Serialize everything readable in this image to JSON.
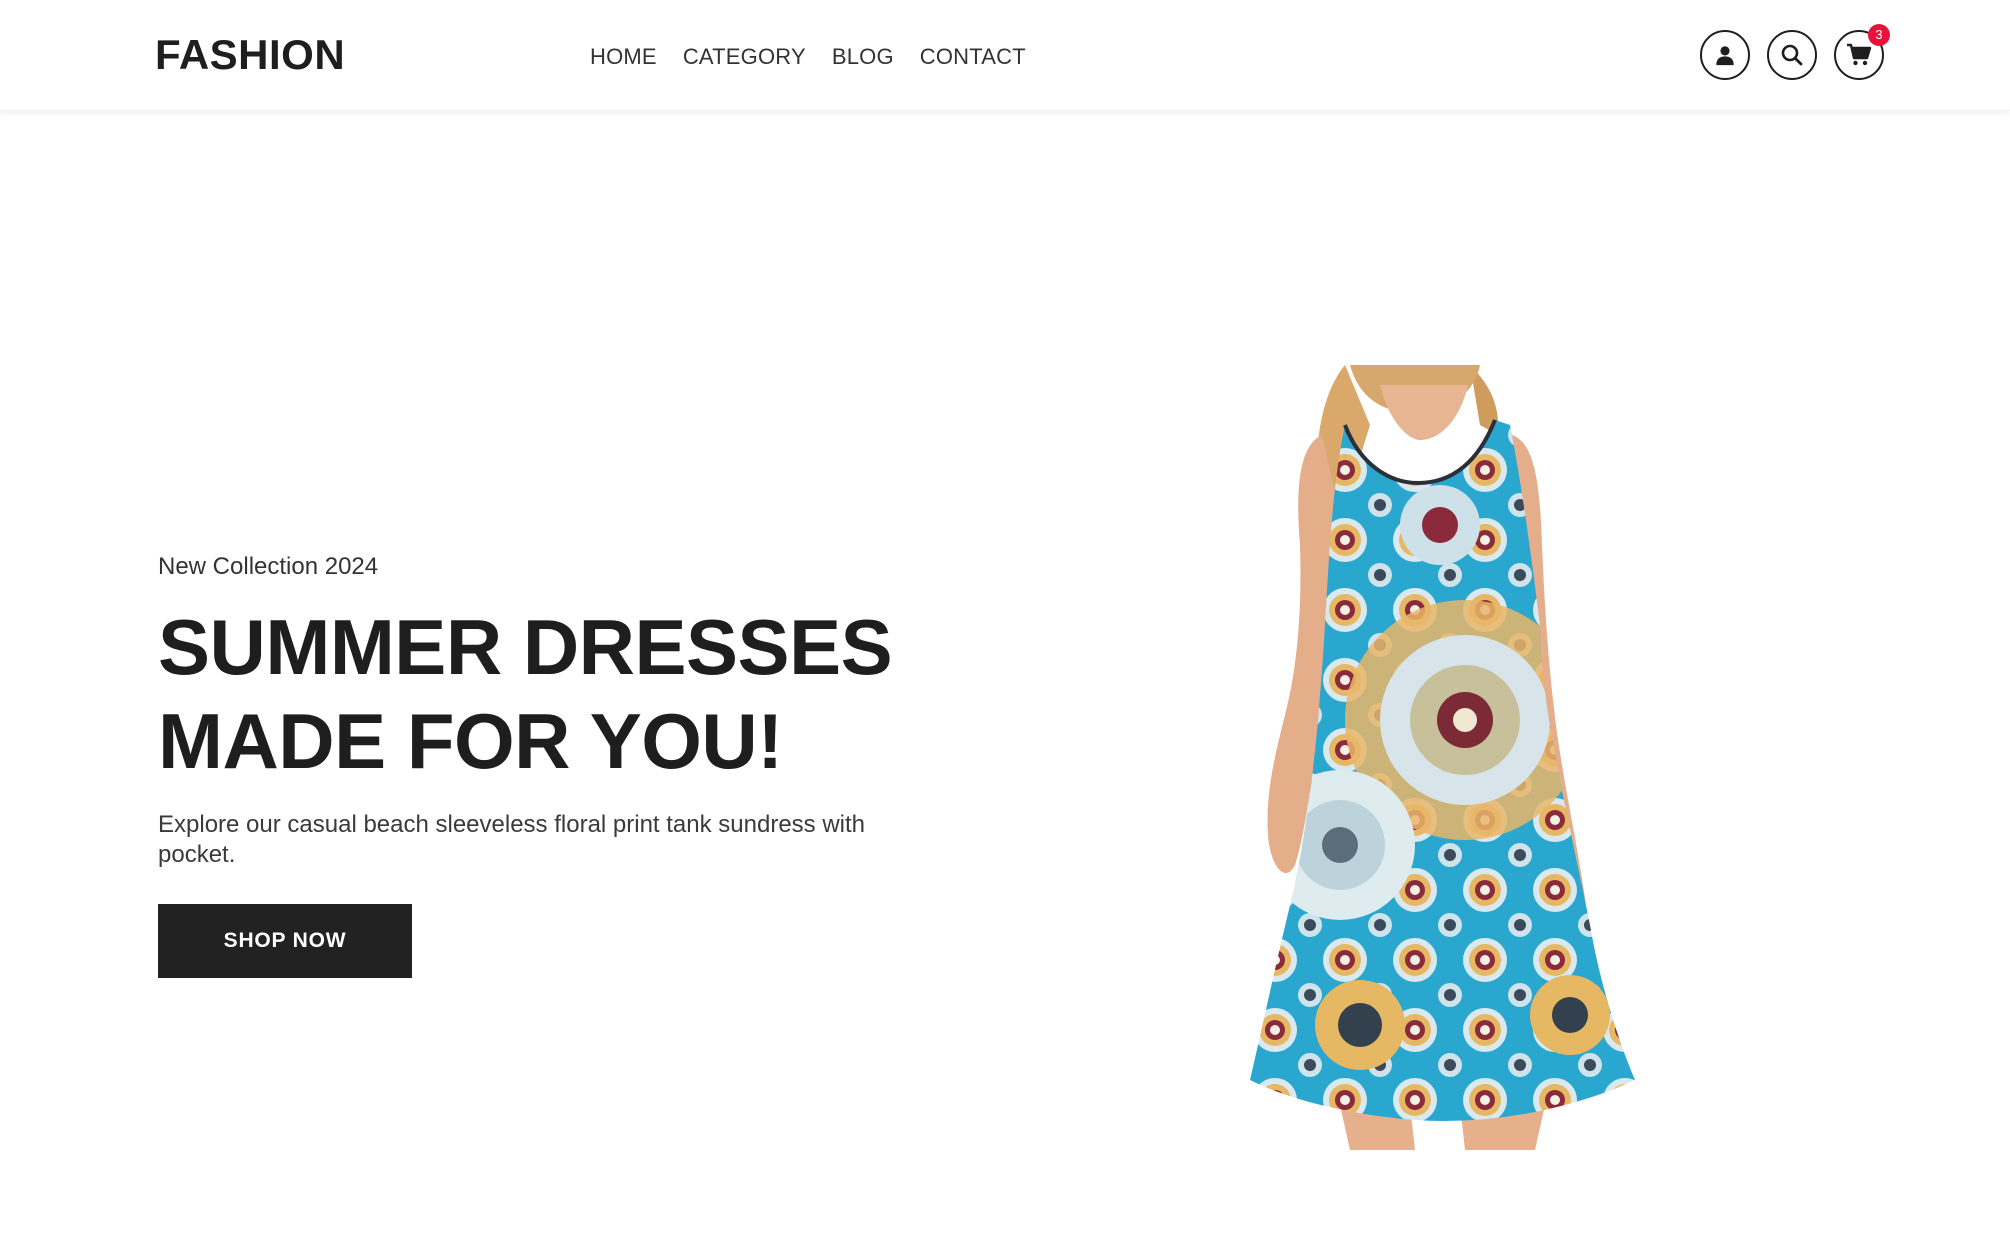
{
  "header": {
    "logo": "FASHION",
    "nav": [
      {
        "label": "HOME"
      },
      {
        "label": "CATEGORY"
      },
      {
        "label": "BLOG"
      },
      {
        "label": "CONTACT"
      }
    ],
    "icons": {
      "account": "user-icon",
      "search": "search-icon",
      "cart": "cart-icon"
    },
    "cart_count": "3",
    "badge_color": "#e8113a"
  },
  "hero": {
    "eyebrow": "New Collection 2024",
    "headline_line1": "SUMMER DRESSES",
    "headline_line2": "MADE FOR YOU!",
    "description": "Explore our casual beach sleeveless floral print tank sundress with pocket.",
    "cta_label": "SHOP NOW",
    "cta_color": "#222222"
  },
  "colors": {
    "text_dark": "#1e1e1e",
    "dress_teal": "#2aa7cf",
    "background": "#ffffff"
  }
}
